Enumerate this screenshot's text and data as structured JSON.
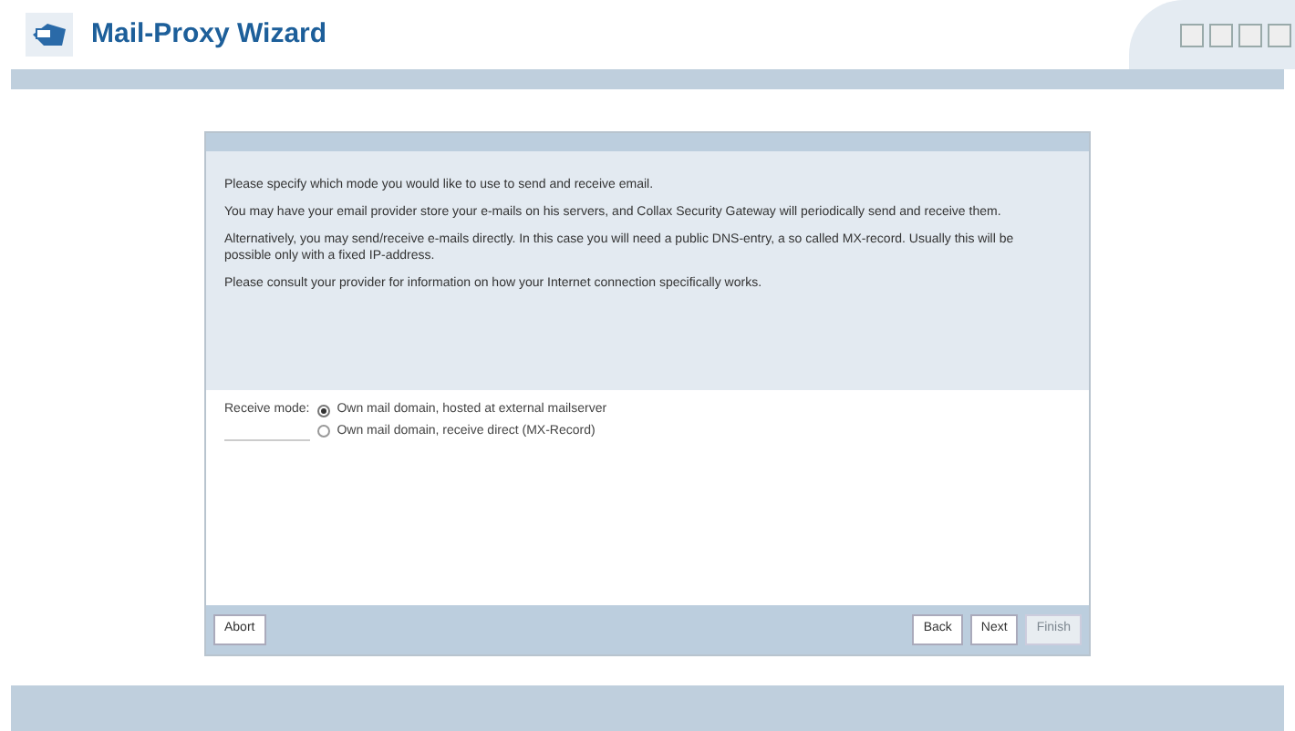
{
  "header": {
    "title": "Mail-Proxy Wizard"
  },
  "intro": [
    "Please specify which mode you would like to use to send and receive email.",
    "You may have your email provider store your e-mails on his servers, and Collax Security Gateway will periodically send and receive them.",
    "Alternatively, you may send/receive e-mails directly. In this case you will need a public DNS-entry, a so called MX-record. Usually this will be possible only with a fixed IP-address.",
    "Please consult your provider for information on how your Internet connection specifically works."
  ],
  "receive_mode": {
    "label": "Receive mode:",
    "options": [
      {
        "label": "Own mail domain, hosted at external mailserver",
        "selected": true
      },
      {
        "label": "Own mail domain, receive direct (MX-Record)",
        "selected": false
      }
    ]
  },
  "buttons": [
    {
      "label": "Abort",
      "disabled": false
    },
    {
      "label": "Back",
      "disabled": false
    },
    {
      "label": "Next",
      "disabled": false
    },
    {
      "label": "Finish",
      "disabled": true
    }
  ]
}
